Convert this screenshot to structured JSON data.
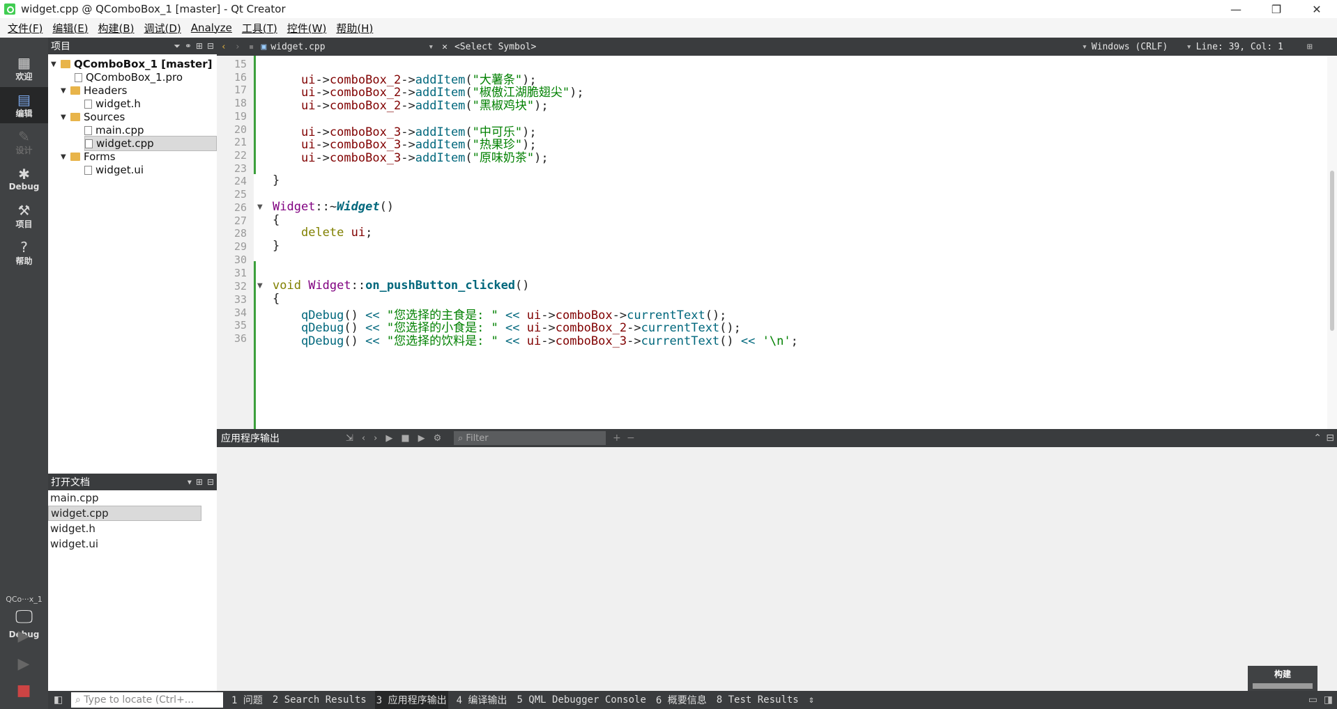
{
  "window": {
    "title": "widget.cpp @ QComboBox_1 [master] - Qt Creator"
  },
  "menu": [
    "文件(F)",
    "编辑(E)",
    "构建(B)",
    "调试(D)",
    "Analyze",
    "工具(T)",
    "控件(W)",
    "帮助(H)"
  ],
  "modes": [
    {
      "label": "欢迎",
      "icon": "grid-icon"
    },
    {
      "label": "编辑",
      "icon": "edit-icon",
      "active": true
    },
    {
      "label": "设计",
      "icon": "pen-icon",
      "disabled": true
    },
    {
      "label": "Debug",
      "icon": "bug-icon"
    },
    {
      "label": "项目",
      "icon": "wrench-icon"
    },
    {
      "label": "帮助",
      "icon": "help-icon"
    }
  ],
  "kit": {
    "project": "QCo···x_1",
    "build": "Debug"
  },
  "project_panel": {
    "title": "项目",
    "tree": [
      {
        "label": "QComboBox_1 [master]",
        "level": 0,
        "type": "project"
      },
      {
        "label": "QComboBox_1.pro",
        "level": 1,
        "type": "file"
      },
      {
        "label": "Headers",
        "level": 1,
        "type": "folder"
      },
      {
        "label": "widget.h",
        "level": 2,
        "type": "file"
      },
      {
        "label": "Sources",
        "level": 1,
        "type": "folder"
      },
      {
        "label": "main.cpp",
        "level": 2,
        "type": "file"
      },
      {
        "label": "widget.cpp",
        "level": 2,
        "type": "file",
        "selected": true
      },
      {
        "label": "Forms",
        "level": 1,
        "type": "folder"
      },
      {
        "label": "widget.ui",
        "level": 2,
        "type": "file"
      }
    ]
  },
  "open_docs": {
    "title": "打开文档",
    "items": [
      "main.cpp",
      "widget.cpp",
      "widget.h",
      "widget.ui"
    ],
    "selected": "widget.cpp"
  },
  "editor_bar": {
    "file": "widget.cpp",
    "symbol": "<Select Symbol>",
    "line_ending": "Windows (CRLF)",
    "position": "Line: 39, Col: 1"
  },
  "code_lines": [
    {
      "n": "15",
      "text": ""
    },
    {
      "n": "16",
      "text": "    ui->comboBox_2->addItem(\"大薯条\");"
    },
    {
      "n": "17",
      "text": "    ui->comboBox_2->addItem(\"椒傲江湖脆翅尖\");"
    },
    {
      "n": "18",
      "text": "    ui->comboBox_2->addItem(\"黑椒鸡块\");"
    },
    {
      "n": "19",
      "text": ""
    },
    {
      "n": "20",
      "text": "    ui->comboBox_3->addItem(\"中可乐\");"
    },
    {
      "n": "21",
      "text": "    ui->comboBox_3->addItem(\"热果珍\");"
    },
    {
      "n": "22",
      "text": "    ui->comboBox_3->addItem(\"原味奶茶\");"
    },
    {
      "n": "23",
      "text": ""
    },
    {
      "n": "24",
      "text": "}"
    },
    {
      "n": "25",
      "text": ""
    },
    {
      "n": "26",
      "text": "Widget::~Widget()"
    },
    {
      "n": "27",
      "text": "{"
    },
    {
      "n": "28",
      "text": "    delete ui;"
    },
    {
      "n": "29",
      "text": "}"
    },
    {
      "n": "30",
      "text": ""
    },
    {
      "n": "31",
      "text": ""
    },
    {
      "n": "32",
      "text": "void Widget::on_pushButton_clicked()"
    },
    {
      "n": "33",
      "text": "{"
    },
    {
      "n": "34",
      "text": "    qDebug() << \"您选择的主食是: \" << ui->comboBox->currentText();"
    },
    {
      "n": "35",
      "text": "    qDebug() << \"您选择的小食是: \" << ui->comboBox_2->currentText();"
    },
    {
      "n": "36",
      "text": "    qDebug() << \"您选择的饮料是: \" << ui->comboBox_3->currentText() << '\\n';"
    }
  ],
  "output_panel": {
    "title": "应用程序输出",
    "filter_placeholder": "Filter"
  },
  "build_box": {
    "label": "构建"
  },
  "status": {
    "locator_placeholder": "Type to locate (Ctrl+...",
    "tabs": [
      "1 问题",
      "2 Search Results",
      "3 应用程序输出",
      "4 编译输出",
      "5 QML Debugger Console",
      "6 概要信息",
      "8 Test Results"
    ],
    "active_tab": "3 应用程序输出"
  },
  "colors": {
    "sidebar": "#404244",
    "panel_header": "#3a3c3e",
    "keyword": "#808000",
    "class": "#800080",
    "member": "#800000",
    "function": "#00677c",
    "string": "#008000"
  }
}
